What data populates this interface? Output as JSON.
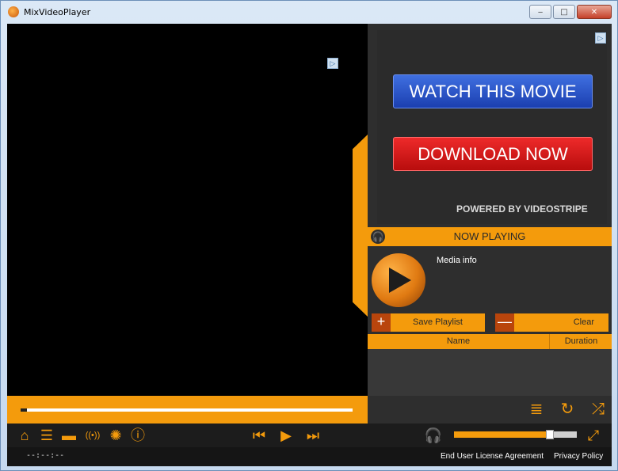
{
  "window": {
    "title": "MixVideoPlayer",
    "minimize": "‒",
    "maximize": "□",
    "close": "✕"
  },
  "ads": {
    "marker": "▷",
    "watch_label": "WATCH THIS MOVIE",
    "download_label": "DOWNLOAD NOW",
    "powered_by": "POWERED BY VIDEOSTRIPE"
  },
  "now_playing": {
    "title": "NOW PLAYING",
    "media_info": "Media info"
  },
  "playlist": {
    "save_label": "Save Playlist",
    "clear_label": "Clear",
    "columns": [
      "Name",
      "Duration"
    ]
  },
  "playback": {
    "time": "--:--:--",
    "seek_progress": 0.02,
    "volume": 0.78
  },
  "footer": {
    "eula": "End User License Agreement",
    "privacy": "Privacy Policy"
  },
  "icons": {
    "home": "⌂",
    "playlist": "☰",
    "folder": "▬",
    "broadcast": "((•))",
    "settings": "✺",
    "info": "ⓘ",
    "prev": "⏮",
    "play": "▶",
    "next": "⏭",
    "headphones": "🎧",
    "fullscreen": "⤢",
    "playlist_sort": "≣",
    "repeat": "↻",
    "shuffle": "⤮",
    "add": "+",
    "remove": "—"
  },
  "colors": {
    "accent": "#f49b0c",
    "background": "#2e2e2e",
    "ad_blue": "#1b3fb0",
    "ad_red": "#d21414"
  }
}
